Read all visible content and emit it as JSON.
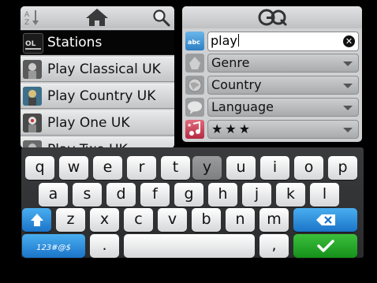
{
  "left_toolbar": {
    "sort_icon_text": "AZ",
    "icons": [
      "sort-az-icon",
      "home-icon",
      "search-icon"
    ]
  },
  "stations": [
    {
      "label": "Stations",
      "selected": true,
      "icon": "stations-logo-icon"
    },
    {
      "label": "Play Classical UK",
      "selected": false,
      "icon": "station-thumbnail-icon"
    },
    {
      "label": "Play Country UK",
      "selected": false,
      "icon": "station-thumbnail-icon"
    },
    {
      "label": "Play One UK",
      "selected": false,
      "icon": "station-thumbnail-icon"
    },
    {
      "label": "Play Two UK",
      "selected": false,
      "icon": "station-thumbnail-icon"
    }
  ],
  "right_toolbar": {
    "logo_icon": "go-logo-icon"
  },
  "search": {
    "value": "play",
    "icon_text": "abc",
    "clear_icon": "clear-icon"
  },
  "filters": {
    "genre": {
      "label": "Genre",
      "icon": "genre-icon"
    },
    "country": {
      "label": "Country",
      "icon": "country-icon"
    },
    "language": {
      "label": "Language",
      "icon": "language-icon"
    },
    "rating": {
      "label": "★★★",
      "icon": "favorite-music-icon"
    }
  },
  "keyboard": {
    "row1": [
      "q",
      "w",
      "e",
      "r",
      "t",
      "y",
      "u",
      "i",
      "o",
      "p"
    ],
    "row2": [
      "a",
      "s",
      "d",
      "f",
      "g",
      "h",
      "j",
      "k",
      "l"
    ],
    "row3": [
      "z",
      "x",
      "c",
      "v",
      "b",
      "n",
      "m"
    ],
    "pressed_key": "y",
    "symbols_label": "123#@$",
    "period_label": ".",
    "comma_label": ",",
    "colors": {
      "shift": "#2a8ee0",
      "backspace": "#2a8ee0",
      "enter": "#1fa024"
    }
  }
}
